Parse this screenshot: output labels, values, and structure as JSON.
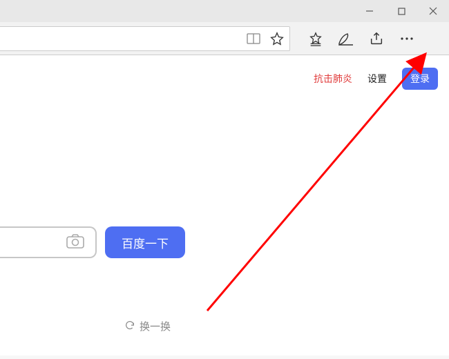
{
  "window": {
    "minimize": "—",
    "maximize": "☐",
    "close": "✕"
  },
  "toolbar": {
    "reading_icon": "reading-view",
    "star_icon": "favorites-star",
    "fav_list_icon": "favorites-list",
    "notes_icon": "web-notes",
    "share_icon": "share",
    "more_icon": "more-menu"
  },
  "page": {
    "links": {
      "covid": "抗击肺炎",
      "settings": "设置",
      "login": "登录"
    },
    "search_button": "百度一下",
    "refresh_label": "换一换"
  }
}
